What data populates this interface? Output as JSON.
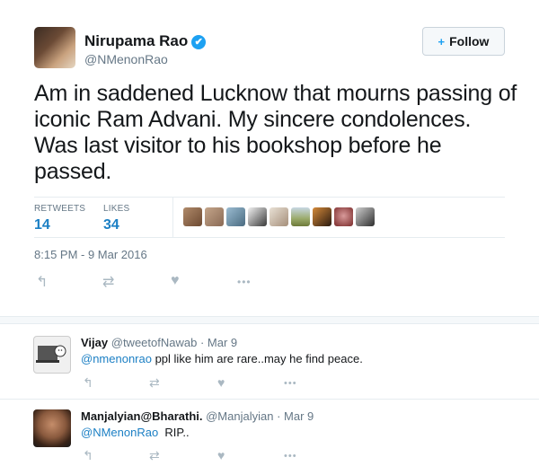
{
  "tweet": {
    "author_name": "Nirupama Rao",
    "author_handle": "@NMenonRao",
    "verified_mark": "✔",
    "follow_icon": "+",
    "follow_label": "Follow",
    "text": "Am in saddened Lucknow that mourns passing of iconic Ram Advani. My sincere condolences. Was last visitor to his bookshop before he passed.",
    "retweets_label": "RETWEETS",
    "retweets_count": "14",
    "likes_label": "LIKES",
    "likes_count": "34",
    "timestamp": "8:15 PM - 9 Mar 2016",
    "actions": {
      "reply": "↰",
      "retweet": "⇄",
      "like": "♥",
      "more": "•••"
    }
  },
  "replies": [
    {
      "name": "Vijay",
      "handle": "@tweetofNawab",
      "time": "· Mar 9",
      "mention": "@nmenonrao",
      "text": " ppl like him are rare..may he find peace."
    },
    {
      "name": "Manjalyian@Bharathi.",
      "handle": "@Manjalyian",
      "time": "· Mar 9",
      "mention": "@NMenonRao",
      "text": "  RIP.."
    }
  ],
  "colors": {
    "link": "#1b7fc4",
    "verified": "#1da1f2",
    "muted": "#657786",
    "icon": "#aab8c2"
  }
}
